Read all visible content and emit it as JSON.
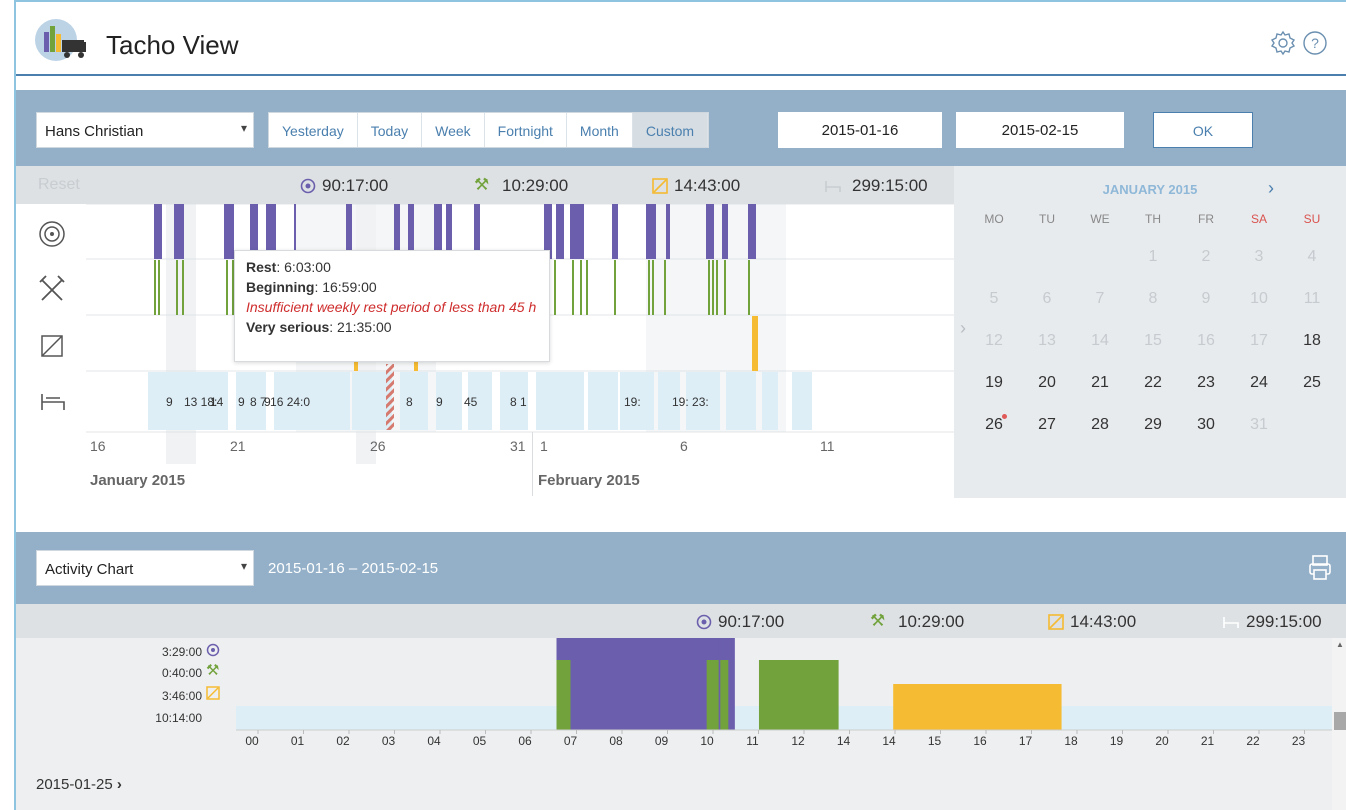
{
  "app": {
    "title": "Tacho View"
  },
  "header": {
    "settings_icon": "gear-icon",
    "help_icon": "help-circle-icon"
  },
  "filter": {
    "driver": "Hans Christian",
    "tabs": [
      {
        "label": "Yesterday",
        "active": false
      },
      {
        "label": "Today",
        "active": false
      },
      {
        "label": "Week",
        "active": false
      },
      {
        "label": "Fortnight",
        "active": false
      },
      {
        "label": "Month",
        "active": false
      },
      {
        "label": "Custom",
        "active": true
      }
    ],
    "date_from": "2015-01-16",
    "date_to": "2015-02-15",
    "ok_label": "OK"
  },
  "timeline": {
    "reset_label": "Reset",
    "stats": {
      "driving": "90:17:00",
      "work": "10:29:00",
      "availability": "14:43:00",
      "rest": "299:15:00"
    },
    "axis_days": [
      "16",
      "21",
      "26",
      "31",
      "1",
      "6",
      "11"
    ],
    "months": [
      "January 2015",
      "February 2015"
    ],
    "rest_labels": [
      "9",
      "13 18:",
      "14",
      "9",
      "8 7 16 24:0",
      "9",
      "8",
      "9",
      "45",
      "8 1",
      "19:",
      "19: 23:"
    ]
  },
  "tooltip": {
    "rest_label": "Rest",
    "rest_value": ": 6:03:00",
    "beginning_label": "Beginning",
    "beginning_value": ": 16:59:00",
    "warning": "Insufficient weekly rest period of less than 45 h",
    "severity_label": "Very serious",
    "severity_value": ": 21:35:00"
  },
  "calendar": {
    "month_label": "JANUARY 2015",
    "day_names": [
      "MO",
      "TU",
      "WE",
      "TH",
      "FR",
      "SA",
      "SU"
    ],
    "rows": [
      [
        "",
        "",
        "",
        "1",
        "2",
        "3",
        "4"
      ],
      [
        "5",
        "6",
        "7",
        "8",
        "9",
        "10",
        "11"
      ],
      [
        "12",
        "13",
        "14",
        "15",
        "16",
        "17",
        "18"
      ],
      [
        "19",
        "20",
        "21",
        "22",
        "23",
        "24",
        "25"
      ],
      [
        "26",
        "27",
        "28",
        "29",
        "30",
        "31",
        ""
      ]
    ],
    "weekend_color": "#d9534f",
    "marked_day": "26"
  },
  "activity": {
    "view": "Activity Chart",
    "range_label": "2015-01-16  –  2015-02-15",
    "print_icon": "printer-icon",
    "stats": {
      "driving": "90:17:00",
      "work": "10:29:00",
      "availability": "14:43:00",
      "rest": "299:15:00"
    },
    "day_totals": {
      "driving": "3:29:00",
      "work": "0:40:00",
      "availability": "3:46:00",
      "rest": "10:14:00"
    },
    "hours": [
      "00",
      "01",
      "02",
      "03",
      "04",
      "05",
      "06",
      "07",
      "08",
      "09",
      "10",
      "11",
      "12",
      "14",
      "14",
      "15",
      "16",
      "17",
      "18",
      "19",
      "20",
      "21",
      "22",
      "23"
    ],
    "day_label": "2015-01-25"
  },
  "colors": {
    "driving": "#6b5fad",
    "work": "#72a23c",
    "availability": "#f5bb33",
    "rest": "#ddeef7",
    "accent": "#4a7fae",
    "band": "#93b0c8"
  }
}
